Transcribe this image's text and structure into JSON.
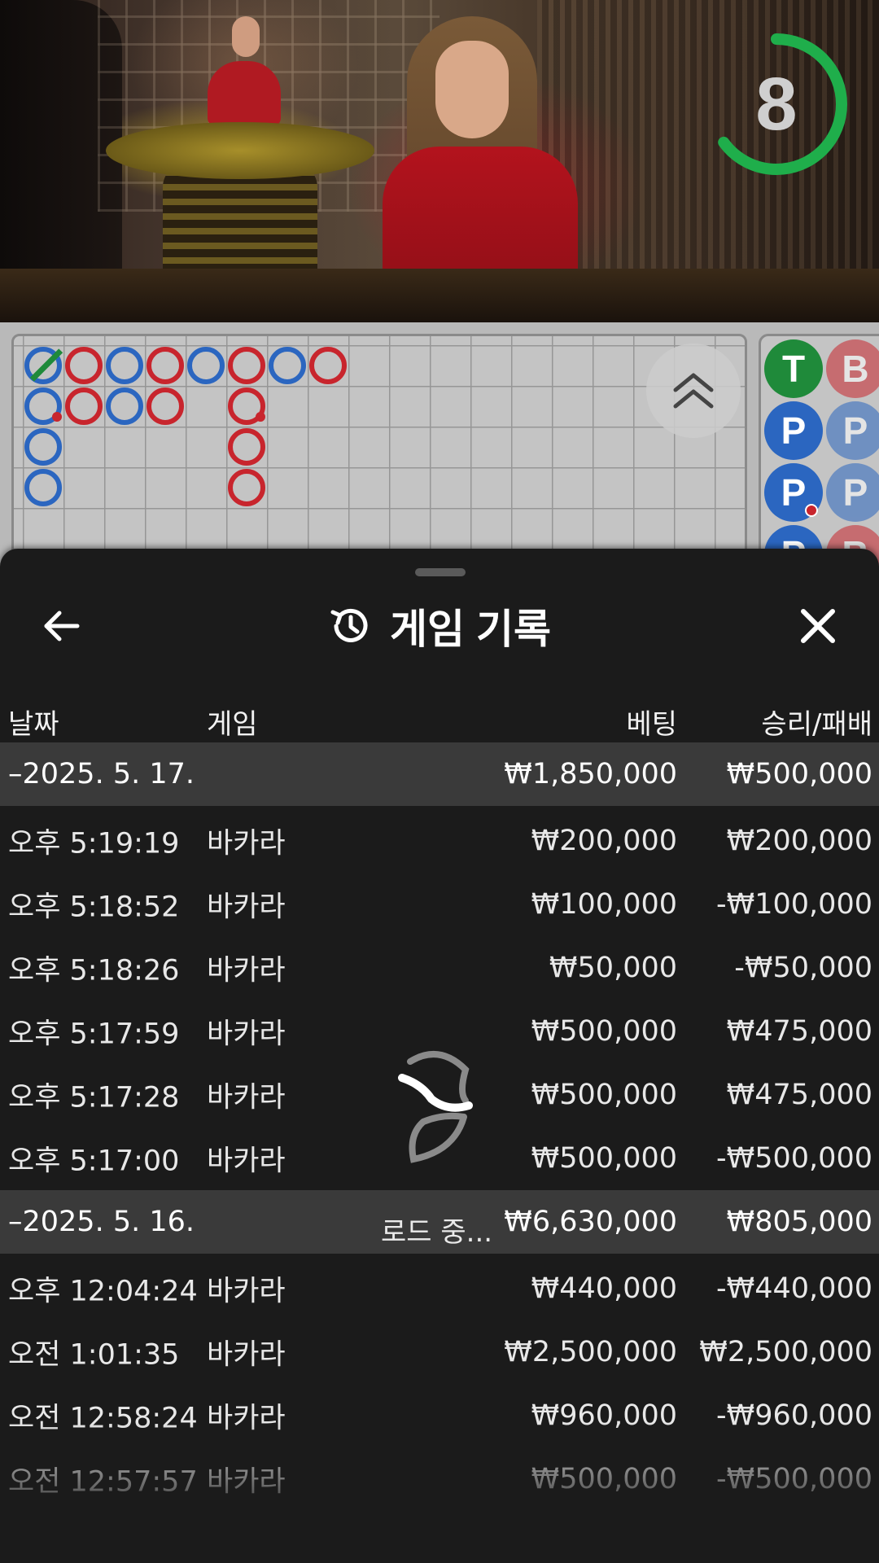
{
  "timer": {
    "seconds": "8",
    "remaining_fraction": 0.65,
    "color": "#1fae4b"
  },
  "big_road": {
    "colors": {
      "banker": "#c8252d",
      "player": "#2b66c0",
      "tie": "#1f8a3a"
    },
    "columns": [
      [
        {
          "s": "P",
          "tie": true
        },
        {
          "s": "P",
          "pair": true
        },
        {
          "s": "P"
        },
        {
          "s": "P"
        }
      ],
      [
        {
          "s": "B"
        },
        {
          "s": "B"
        }
      ],
      [
        {
          "s": "P"
        },
        {
          "s": "P"
        }
      ],
      [
        {
          "s": "B"
        },
        {
          "s": "B"
        }
      ],
      [
        {
          "s": "P"
        }
      ],
      [
        {
          "s": "B"
        },
        {
          "s": "B",
          "pair": true
        },
        {
          "s": "B"
        },
        {
          "s": "B"
        }
      ],
      [
        {
          "s": "P"
        }
      ],
      [
        {
          "s": "B"
        }
      ]
    ]
  },
  "bead_road": {
    "colors": {
      "T": "#1f8a3a",
      "B": "#c8252d",
      "P": "#2b66c0"
    },
    "rows": [
      [
        {
          "l": "T"
        },
        {
          "l": "B"
        }
      ],
      [
        {
          "l": "P"
        },
        {
          "l": "P"
        }
      ],
      [
        {
          "l": "P",
          "pair": true
        },
        {
          "l": "P"
        }
      ],
      [
        {
          "l": "P"
        },
        {
          "l": "B"
        }
      ]
    ]
  },
  "sheet": {
    "title": "게임 기록",
    "back_icon": "arrow-left-icon",
    "history_icon": "history-clock-icon",
    "close_icon": "close-icon"
  },
  "columns": {
    "date": "날짜",
    "game": "게임",
    "bet": "베팅",
    "win": "승리/패배"
  },
  "history": [
    {
      "date": "–2025. 5. 17.",
      "bet": "₩1,850,000",
      "win": "₩500,000",
      "rows": [
        {
          "time": "오후 5:19:19",
          "game": "바카라",
          "bet": "₩200,000",
          "win": "₩200,000"
        },
        {
          "time": "오후 5:18:52",
          "game": "바카라",
          "bet": "₩100,000",
          "win": "-₩100,000"
        },
        {
          "time": "오후 5:18:26",
          "game": "바카라",
          "bet": "₩50,000",
          "win": "-₩50,000"
        },
        {
          "time": "오후 5:17:59",
          "game": "바카라",
          "bet": "₩500,000",
          "win": "₩475,000"
        },
        {
          "time": "오후 5:17:28",
          "game": "바카라",
          "bet": "₩500,000",
          "win": "₩475,000"
        },
        {
          "time": "오후 5:17:00",
          "game": "바카라",
          "bet": "₩500,000",
          "win": "-₩500,000"
        }
      ]
    },
    {
      "date": "–2025. 5. 16.",
      "bet": "₩6,630,000",
      "win": "₩805,000",
      "rows": [
        {
          "time": "오후 12:04:24",
          "game": "바카라",
          "bet": "₩440,000",
          "win": "-₩440,000"
        },
        {
          "time": "오전 1:01:35",
          "game": "바카라",
          "bet": "₩2,500,000",
          "win": "₩2,500,000"
        },
        {
          "time": "오전 12:58:24",
          "game": "바카라",
          "bet": "₩960,000",
          "win": "-₩960,000"
        },
        {
          "time": "오전 12:57:57",
          "game": "바카라",
          "bet": "₩500,000",
          "win": "-₩500,000"
        }
      ]
    }
  ],
  "loading": {
    "text": "로드 중...",
    "icon": "loading-spinner-icon"
  }
}
